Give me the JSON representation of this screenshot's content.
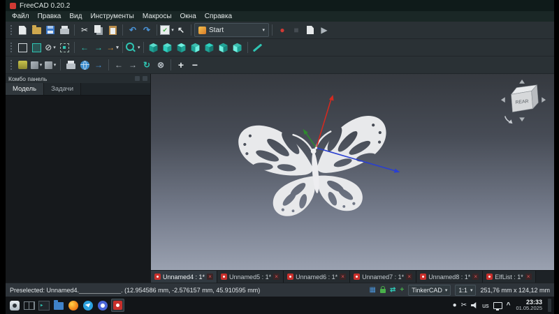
{
  "titlebar": {
    "title": "FreeCAD 0.20.2"
  },
  "menus": [
    "Файл",
    "Правка",
    "Вид",
    "Инструменты",
    "Макросы",
    "Окна",
    "Справка"
  ],
  "workbench": {
    "selected": "Start"
  },
  "combo_panel": {
    "title": "Комбо панель",
    "tabs": [
      "Модель",
      "Задачи"
    ]
  },
  "viewport": {
    "navcube_face": "REAR"
  },
  "doc_tabs": [
    {
      "label": "Unnamed4 : 1*"
    },
    {
      "label": "Unnamed5 : 1*"
    },
    {
      "label": "Unnamed6 : 1*"
    },
    {
      "label": "Unnamed7 : 1*"
    },
    {
      "label": "Unnamed8 : 1*"
    },
    {
      "label": "ElfList : 1*"
    }
  ],
  "statusbar": {
    "preselected": "Preselected: Unnamed4.____________. (12.954586 mm, -2.576157 mm, 45.910595 mm)",
    "nav_style": "TinkerCAD",
    "scale": "1:1",
    "dimensions": "251,76 mm x 124,12 mm"
  },
  "taskbar": {
    "keyboard_layout": "us",
    "time": "23:33",
    "date": "01.05.2025"
  },
  "glyphs": {
    "dropdown": "▾",
    "close": "×",
    "cut": "✂",
    "undo": "↶",
    "redo": "↷",
    "check": "✔",
    "cursor": "↖",
    "record": "●",
    "stop": "■",
    "play": "▶",
    "arrow_left": "←",
    "arrow_right": "→",
    "draw_style": "⊘",
    "refresh": "↻",
    "abort": "⊗",
    "plus": "+",
    "minus": "−",
    "grid": "▦",
    "sync": "⇄",
    "chevron_up": "^"
  },
  "colors": {
    "accent": "#2fc4b2",
    "record_red": "#d03a34",
    "viewport_top": "#35393f",
    "viewport_bottom": "#9aa1b0",
    "axis_red": "#d42a20",
    "axis_green": "#2e8b2e",
    "axis_blue": "#2a3fd0"
  }
}
